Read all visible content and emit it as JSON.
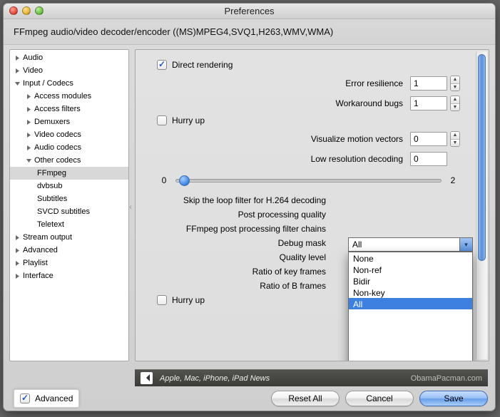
{
  "window": {
    "title": "Preferences"
  },
  "subtitle": "FFmpeg audio/video decoder/encoder ((MS)MPEG4,SVQ1,H263,WMV,WMA)",
  "sidebar": {
    "items": [
      {
        "label": "Audio",
        "expanded": false,
        "depth": 0
      },
      {
        "label": "Video",
        "expanded": false,
        "depth": 0
      },
      {
        "label": "Input / Codecs",
        "expanded": true,
        "depth": 0
      },
      {
        "label": "Access modules",
        "expanded": false,
        "depth": 1
      },
      {
        "label": "Access filters",
        "expanded": false,
        "depth": 1
      },
      {
        "label": "Demuxers",
        "expanded": false,
        "depth": 1
      },
      {
        "label": "Video codecs",
        "expanded": false,
        "depth": 1
      },
      {
        "label": "Audio codecs",
        "expanded": false,
        "depth": 1
      },
      {
        "label": "Other codecs",
        "expanded": true,
        "depth": 1
      },
      {
        "label": "FFmpeg",
        "depth": 2,
        "selected": true
      },
      {
        "label": "dvbsub",
        "depth": 2
      },
      {
        "label": "Subtitles",
        "depth": 2
      },
      {
        "label": "SVCD subtitles",
        "depth": 2
      },
      {
        "label": "Teletext",
        "depth": 2
      },
      {
        "label": "Stream output",
        "expanded": false,
        "depth": 0
      },
      {
        "label": "Advanced",
        "expanded": false,
        "depth": 0
      },
      {
        "label": "Playlist",
        "expanded": false,
        "depth": 0
      },
      {
        "label": "Interface",
        "expanded": false,
        "depth": 0
      }
    ]
  },
  "content": {
    "direct_rendering": {
      "label": "Direct rendering",
      "checked": true
    },
    "error_resilience": {
      "label": "Error resilience",
      "value": "1"
    },
    "workaround_bugs": {
      "label": "Workaround bugs",
      "value": "1"
    },
    "hurry_up_1": {
      "label": "Hurry up",
      "checked": false
    },
    "visualize_motion": {
      "label": "Visualize motion vectors",
      "value": "0"
    },
    "low_res_decoding": {
      "label": "Low resolution decoding",
      "value": "0"
    },
    "slider": {
      "min": "0",
      "max": "2",
      "pos": 0.03
    },
    "skip_loop": {
      "label": "Skip the loop filter for H.264 decoding",
      "value": "All",
      "options": [
        "None",
        "Non-ref",
        "Bidir",
        "Non-key",
        "All"
      ]
    },
    "post_processing_quality": {
      "label": "Post processing quality"
    },
    "ffmpeg_pp_chains": {
      "label": "FFmpeg post processing filter chains"
    },
    "debug_mask": {
      "label": "Debug mask"
    },
    "quality_level": {
      "label": "Quality level"
    },
    "ratio_key": {
      "label": "Ratio of key frames"
    },
    "ratio_b": {
      "label": "Ratio of B frames"
    },
    "hurry_up_2": {
      "label": "Hurry up",
      "checked": false
    }
  },
  "footer": {
    "advanced": {
      "label": "Advanced",
      "checked": true
    },
    "reset": "Reset All",
    "cancel": "Cancel",
    "save": "Save"
  },
  "status": {
    "left": "Apple, Mac, iPhone, iPad News",
    "right": "ObamaPacman.com"
  }
}
